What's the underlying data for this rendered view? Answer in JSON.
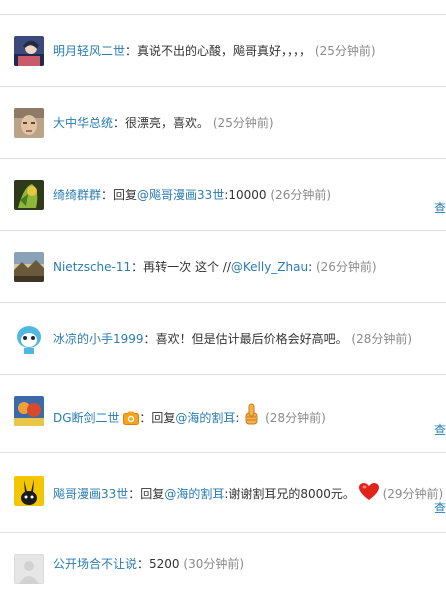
{
  "comments": [
    {
      "user": "明月轻风二世",
      "separator": "：",
      "text": "真说不出的心酸，飚哥真好，，，，",
      "time": "(25分钟前)",
      "avatar_icon": "anime-character-avatar"
    },
    {
      "user": "大中华总统",
      "separator": "：",
      "text": "很漂亮，喜欢。",
      "time": "(25分钟前)",
      "avatar_icon": "face-photo-avatar"
    },
    {
      "user": "绮绮群群",
      "separator": "：",
      "reply_prefix": "回复",
      "mention": "@飚哥漫画33世",
      "text": ":10000",
      "time": "(26分钟前)",
      "side_link": "查",
      "avatar_icon": "green-yellow-avatar"
    },
    {
      "user": "Nietzsche-11",
      "separator": "：",
      "text": "再转一次 这个 //",
      "mention": "@Kelly_Zhau",
      "text_after": ":",
      "time": "(26分钟前)",
      "avatar_icon": "landscape-avatar"
    },
    {
      "user": "冰凉的小手1999",
      "separator": "：",
      "text": "喜欢！但是估计最后价格会好高吧。",
      "time": "(28分钟前)",
      "avatar_icon": "blue-cartoon-avatar"
    },
    {
      "user": "DG断剑二世",
      "separator": "：",
      "reply_prefix": "回复",
      "mention": "@海的割耳",
      "text": ":",
      "time": "(28分钟前)",
      "side_link": "查",
      "badge_icon": "camera-badge-icon",
      "emoji_icon": "thumbs-up-icon",
      "avatar_icon": "colorful-group-avatar"
    },
    {
      "user": "飚哥漫画33世",
      "separator": "：",
      "reply_prefix": "回复",
      "mention": "@海的割耳",
      "text": ":谢谢割耳兄的8000元。",
      "time": "(29分钟前)",
      "side_link": "查",
      "emoji_icon": "heart-icon",
      "avatar_icon": "yellow-rabbit-avatar"
    },
    {
      "user": "公开场合不让说",
      "separator": "：",
      "text": "5200",
      "time": "(30分钟前)",
      "avatar_icon": "default-gray-avatar"
    }
  ]
}
